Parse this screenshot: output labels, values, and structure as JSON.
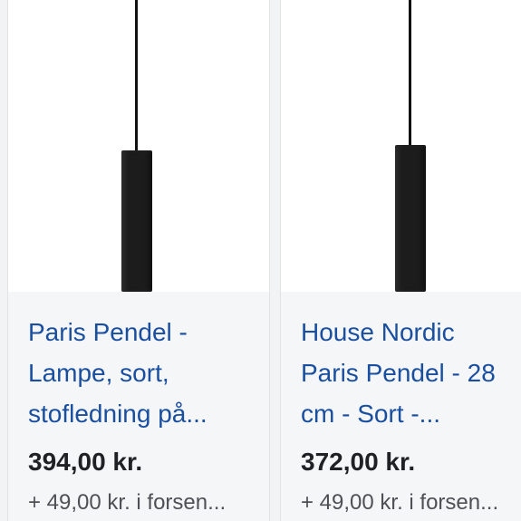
{
  "products": [
    {
      "title_lines": [
        "Paris Pendel -",
        "Lampe, sort,",
        "stofledning på..."
      ],
      "price": "394,00 kr.",
      "shipping": "+ 49,00 kr. i forsen..."
    },
    {
      "title_lines": [
        "House Nordic",
        "Paris Pendel - 28",
        "cm - Sort -..."
      ],
      "price": "372,00 kr.",
      "shipping": "+ 49,00 kr. i forsen..."
    }
  ],
  "colors": {
    "title": "#1a4fa0",
    "price": "#202124",
    "shipping": "#4d5156",
    "card_info_bg": "#f5f6f7"
  }
}
